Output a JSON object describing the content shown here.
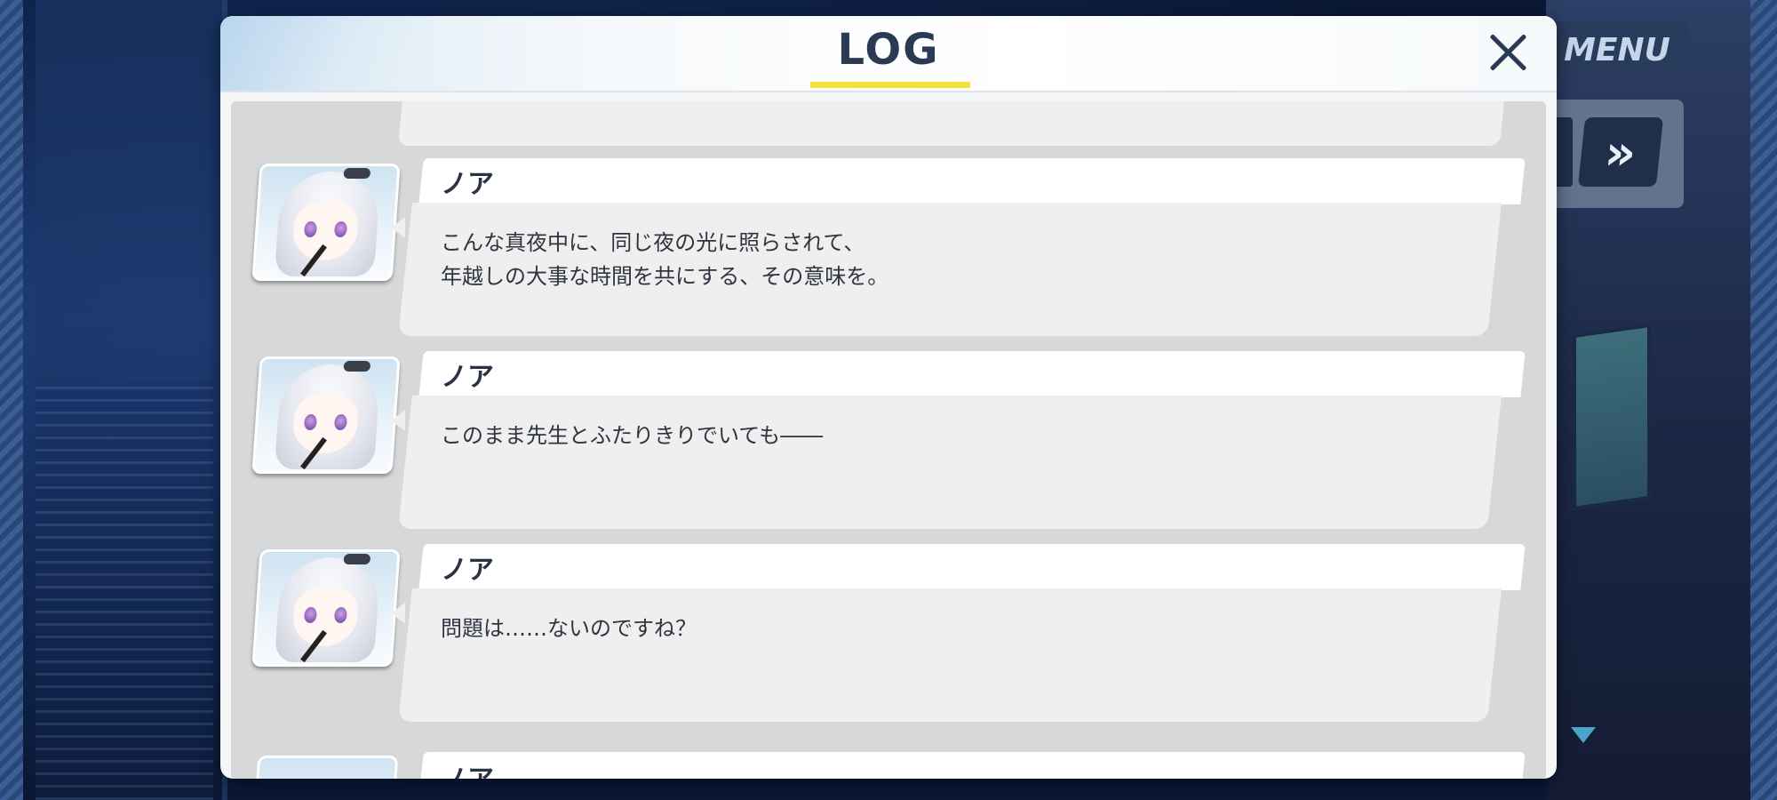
{
  "background": {
    "description_color": "#0b1a33"
  },
  "menu": {
    "label": "MENU"
  },
  "skip_button": {
    "icon": "double-chevron-right-icon",
    "glyph": "»"
  },
  "log": {
    "title": "LOG",
    "accent_color": "#f5e13a",
    "close_icon": "close-icon",
    "entries": [
      {
        "speaker": "ノア",
        "text": "こんな真夜中に、同じ夜の光に照らされて、\n年越しの大事な時間を共にする、その意味を。"
      },
      {
        "speaker": "ノア",
        "text": "このまま先生とふたりきりでいても――"
      },
      {
        "speaker": "ノア",
        "text": "問題は……ないのですね？"
      }
    ],
    "partial_entry": {
      "speaker": "ノア"
    }
  }
}
